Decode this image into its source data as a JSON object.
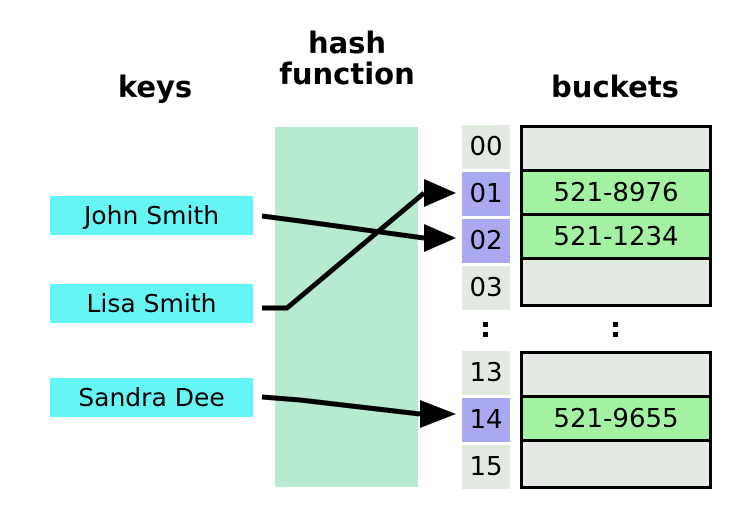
{
  "headings": {
    "keys": "keys",
    "hash_function": "hash\nfunction",
    "buckets": "buckets"
  },
  "keys": [
    {
      "label": "John Smith",
      "maps_to_index": "02"
    },
    {
      "label": "Lisa Smith",
      "maps_to_index": "01"
    },
    {
      "label": "Sandra Dee",
      "maps_to_index": "14"
    }
  ],
  "table": {
    "top_section": [
      {
        "index": "00",
        "value": "",
        "filled": false,
        "highlighted": false
      },
      {
        "index": "01",
        "value": "521-8976",
        "filled": true,
        "highlighted": true
      },
      {
        "index": "02",
        "value": "521-1234",
        "filled": true,
        "highlighted": true
      },
      {
        "index": "03",
        "value": "",
        "filled": false,
        "highlighted": false
      }
    ],
    "bottom_section": [
      {
        "index": "13",
        "value": "",
        "filled": false,
        "highlighted": false
      },
      {
        "index": "14",
        "value": "521-9655",
        "filled": true,
        "highlighted": true
      },
      {
        "index": "15",
        "value": "",
        "filled": false,
        "highlighted": false
      }
    ],
    "ellipsis_mark": "⋮"
  },
  "colors": {
    "key_box": "#66f5f5",
    "hash_band": "#b7ebcf",
    "index_empty": "#e2eae2",
    "index_highlight": "#a9a9f0",
    "bucket_empty": "#e2eae2",
    "bucket_filled": "#a2f2a2",
    "stroke": "#000000",
    "background": "#ffffff"
  }
}
